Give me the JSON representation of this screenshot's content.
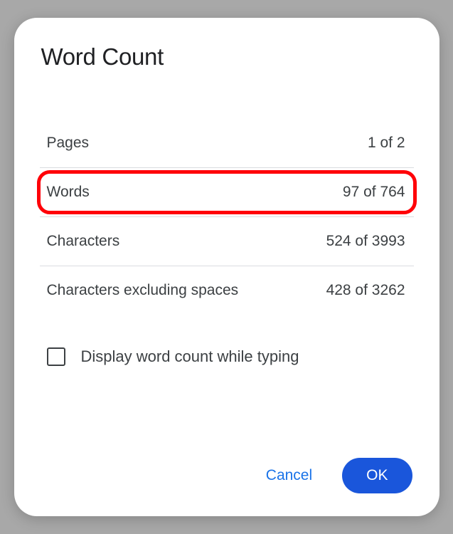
{
  "dialog": {
    "title": "Word Count",
    "stats": {
      "pages": {
        "label": "Pages",
        "value": "1 of 2"
      },
      "words": {
        "label": "Words",
        "value": "97 of 764"
      },
      "characters": {
        "label": "Characters",
        "value": "524 of 3993"
      },
      "characters_no_spaces": {
        "label": "Characters excluding spaces",
        "value": "428 of 3262"
      }
    },
    "checkbox_label": "Display word count while typing",
    "buttons": {
      "cancel": "Cancel",
      "ok": "OK"
    }
  }
}
